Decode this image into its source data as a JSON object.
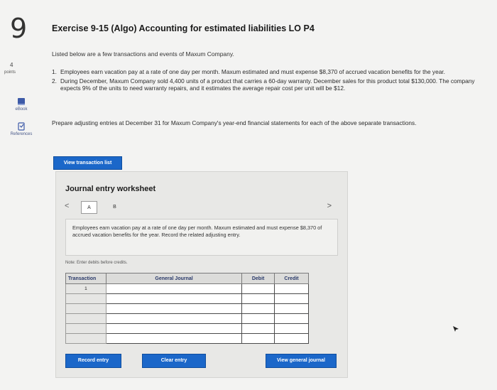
{
  "question": {
    "number": "9",
    "points_value": "4",
    "points_label": "points"
  },
  "sidebar": {
    "ebook_label": "eBook",
    "references_label": "References"
  },
  "exercise": {
    "title": "Exercise 9-15 (Algo) Accounting for estimated liabilities LO P4",
    "intro": "Listed below are a few transactions and events of Maxum Company.",
    "items": [
      {
        "num": "1.",
        "text": "Employees earn vacation pay at a rate of one day per month. Maxum estimated and must expense $8,370 of accrued vacation benefits for the year."
      },
      {
        "num": "2.",
        "text": "During December, Maxum Company sold 4,400 units of a product that carries a 60-day warranty. December sales for this product total $130,000. The company expects 9% of the units to need warranty repairs, and it estimates the average repair cost per unit will be $12."
      }
    ],
    "prepare": "Prepare adjusting entries at December 31 for Maxum Company's year-end financial statements for each of the above separate transactions."
  },
  "buttons": {
    "view_transaction_list": "View transaction list",
    "record_entry": "Record entry",
    "clear_entry": "Clear entry",
    "view_general_journal": "View general journal"
  },
  "worksheet": {
    "title": "Journal entry worksheet",
    "prev": "<",
    "next": ">",
    "tabs": [
      "A",
      "B"
    ],
    "description": "Employees earn vacation pay at a rate of one day per month. Maxum estimated and must expense $8,370 of accrued vacation benefits for the year. Record the related adjusting entry.",
    "note": "Note: Enter debits before credits.",
    "columns": [
      "Transaction",
      "General Journal",
      "Debit",
      "Credit"
    ],
    "rows": [
      {
        "transaction": "1",
        "general_journal": "",
        "debit": "",
        "credit": ""
      },
      {
        "transaction": "",
        "general_journal": "",
        "debit": "",
        "credit": ""
      },
      {
        "transaction": "",
        "general_journal": "",
        "debit": "",
        "credit": ""
      },
      {
        "transaction": "",
        "general_journal": "",
        "debit": "",
        "credit": ""
      },
      {
        "transaction": "",
        "general_journal": "",
        "debit": "",
        "credit": ""
      },
      {
        "transaction": "",
        "general_journal": "",
        "debit": "",
        "credit": ""
      }
    ]
  },
  "colors": {
    "accent_blue": "#1b67c9",
    "header_text": "#2a3a6a"
  }
}
